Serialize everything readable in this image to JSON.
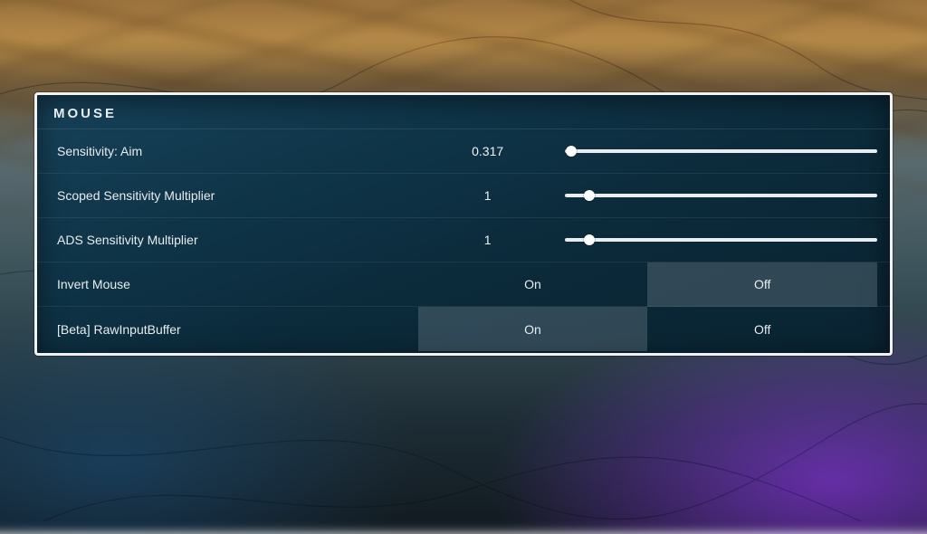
{
  "section_title": "MOUSE",
  "toggle_labels": {
    "on": "On",
    "off": "Off"
  },
  "rows": [
    {
      "kind": "slider",
      "label": "Sensitivity: Aim",
      "value": "0.317",
      "percent": 2
    },
    {
      "kind": "slider",
      "label": "Scoped Sensitivity Multiplier",
      "value": "1",
      "percent": 8
    },
    {
      "kind": "slider",
      "label": "ADS Sensitivity Multiplier",
      "value": "1",
      "percent": 8
    },
    {
      "kind": "toggle",
      "label": "Invert Mouse",
      "selected": "off"
    },
    {
      "kind": "toggle",
      "label": "[Beta] RawInputBuffer",
      "selected": "on"
    }
  ]
}
